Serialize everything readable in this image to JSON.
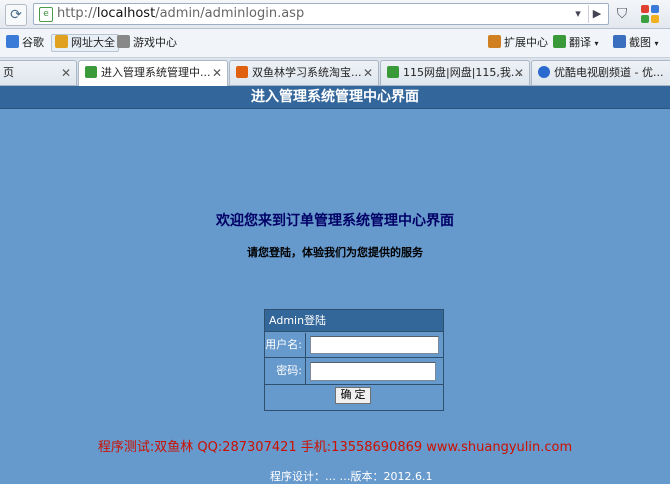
{
  "browser": {
    "url_prefix": "http://",
    "url_host": "localhost",
    "url_path": "/admin/adminlogin.asp",
    "bookmarks": [
      {
        "label": "谷歌",
        "icon": "google-icon",
        "color": "#3b7bd8"
      },
      {
        "label": "网址大全",
        "icon": "sites-icon",
        "color": "#e0a020"
      },
      {
        "label": "游戏中心",
        "icon": "gamepad-icon",
        "color": "#888888"
      }
    ],
    "right_bookmarks": [
      {
        "label": "扩展中心",
        "icon": "extension-icon",
        "color": "#d08020"
      },
      {
        "label": "翻译",
        "icon": "translate-icon",
        "color": "#3a9a3a"
      },
      {
        "label": "截图",
        "icon": "screenshot-icon",
        "color": "#3a6fc0"
      }
    ],
    "tabs": [
      {
        "label": "页",
        "icon": "",
        "color": "#ffffff"
      },
      {
        "label": "进入管理系统管理中...",
        "icon": "page-icon",
        "color": "#3a9a3a",
        "active": true
      },
      {
        "label": "双鱼林学习系统淘宝...",
        "icon": "taobao-icon",
        "color": "#e06010"
      },
      {
        "label": "115网盘|网盘|115,我...",
        "icon": "page-icon",
        "color": "#3a9a3a"
      },
      {
        "label": "优酷电视剧频道 - 优...",
        "icon": "youku-icon",
        "color": "#2a6ad0"
      }
    ]
  },
  "page": {
    "header": "进入管理系统管理中心界面",
    "welcome": "欢迎您来到订单管理系统管理中心界面",
    "subtext": "请您登陆，体验我们为您提供的服务",
    "login": {
      "title": "Admin登陆",
      "username_label": "用户名:",
      "password_label": "密码:",
      "username_value": "",
      "password_value": "",
      "submit_label": "确 定"
    },
    "credits": "程序测试:双鱼林 QQ:287307421 手机:13558690869 www.shuangyulin.com",
    "footer": "程序设计：…  …版本：2012.6.1"
  },
  "colors": {
    "page_bg": "#6699cc",
    "header_bg": "#33669a",
    "credits": "#cc1100",
    "welcome": "#000066"
  }
}
